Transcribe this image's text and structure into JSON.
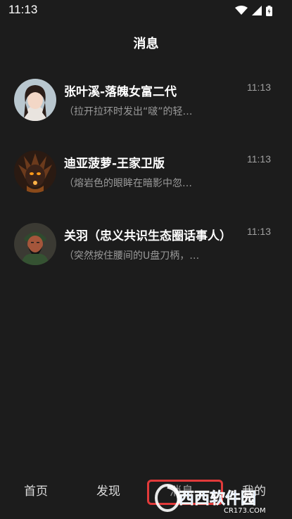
{
  "status": {
    "time": "11:13"
  },
  "header": {
    "title": "消息"
  },
  "conversations": [
    {
      "name": "张叶溪-落魄女富二代",
      "time": "11:13",
      "preview": "（拉开拉环时发出“啵”的轻…"
    },
    {
      "name": "迪亚菠萝-王家卫版",
      "time": "11:13",
      "preview": "（熔岩色的眼眸在暗影中忽…"
    },
    {
      "name": "关羽（忠义共识生态圈话事人）",
      "time": "11:13",
      "preview": "（突然按住腰间的U盘刀柄，…"
    }
  ],
  "tabs": [
    {
      "label": "首页"
    },
    {
      "label": "发现"
    },
    {
      "label": "消息"
    },
    {
      "label": "我的"
    }
  ],
  "watermark": {
    "brand": "西西软件园",
    "site": "CR173.COM"
  },
  "colors": {
    "background": "#1c1c1c",
    "highlight": "#e23a3a",
    "muted": "#9a9a9a"
  }
}
